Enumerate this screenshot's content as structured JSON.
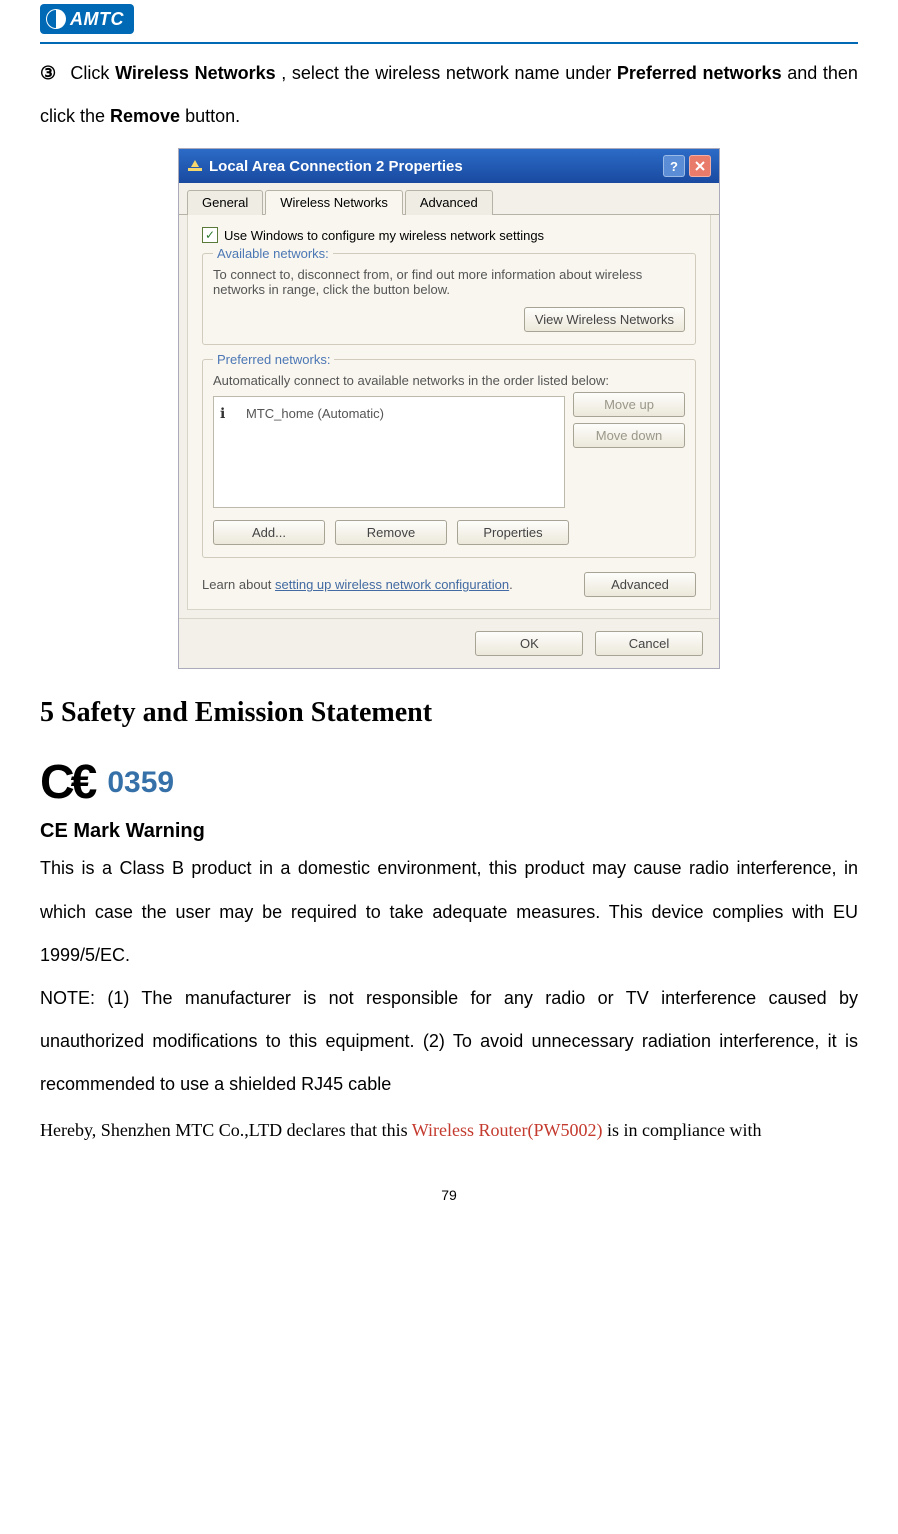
{
  "header": {
    "brand": "AMTC"
  },
  "instruction": {
    "circled": "③",
    "p1a": "Click ",
    "p1b_bold": "Wireless Networks",
    "p1c": ", select the wireless network name under ",
    "p1d_bold": "Preferred networks",
    "p1e": " and then click the ",
    "p1f_bold": "Remove",
    "p1g": " button."
  },
  "dialog": {
    "title": "Local Area Connection 2 Properties",
    "help": "?",
    "close": "×",
    "tabs": {
      "general": "General",
      "wireless": "Wireless Networks",
      "advanced": "Advanced"
    },
    "checkbox": "Use Windows to configure my wireless network settings",
    "available": {
      "legend": "Available networks:",
      "text": "To connect to, disconnect from, or find out more information about wireless networks in range, click the button below.",
      "button": "View Wireless Networks"
    },
    "preferred": {
      "legend": "Preferred networks:",
      "text": "Automatically connect to available networks in the order listed below:",
      "network": "MTC_home (Automatic)",
      "move_up": "Move up",
      "move_down": "Move down",
      "add": "Add...",
      "remove": "Remove",
      "properties": "Properties"
    },
    "learn_a": "Learn about ",
    "learn_link": "setting up wireless network configuration",
    "learn_dot": ".",
    "advanced_btn": "Advanced",
    "ok": "OK",
    "cancel": "Cancel"
  },
  "section5": {
    "heading": "5 Safety and Emission Statement",
    "ce_number": "0359",
    "ce_warning": "CE Mark Warning",
    "p1": "This is a Class B product in a domestic environment, this product may cause radio interference, in which case the user may be required to take adequate measures. This device complies with EU 1999/5/EC.",
    "p2": "NOTE: (1) The manufacturer is not responsible for any radio or TV interference caused by unauthorized modifications to this equipment. (2) To avoid unnecessary radiation interference, it is recommended to use a shielded RJ45 cable",
    "hereby_a": "Hereby, Shenzhen MTC Co.,LTD declares that this ",
    "hereby_red": "Wireless Router(PW5002)",
    "hereby_b": " is in compliance with"
  },
  "page_number": "79"
}
